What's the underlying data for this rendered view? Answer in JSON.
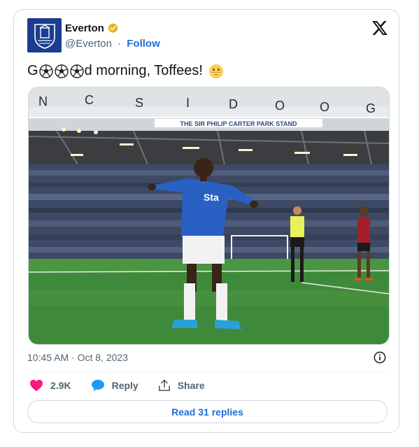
{
  "author": {
    "display_name": "Everton",
    "handle": "@Everton",
    "separator": "·",
    "follow_label": "Follow"
  },
  "tweet": {
    "text_prefix": "G",
    "text_suffix": "d morning, Toffees!",
    "emoji_ball_count": 3,
    "emoji_end": "grinning-face"
  },
  "media": {
    "stand_sign": "THE SIR PHILIP CARTER PARK STAND",
    "shirt_text": "Sta"
  },
  "meta": {
    "timestamp": "10:45 AM · Oct 8, 2023"
  },
  "actions": {
    "likes_count": "2.9K",
    "reply_label": "Reply",
    "share_label": "Share"
  },
  "footer": {
    "read_replies_label": "Read 31 replies"
  },
  "colors": {
    "accent": "#1d6ed8",
    "like": "#f91880",
    "reply_icon": "#1d9bf0",
    "everton_blue": "#1b3d8f",
    "pitch": "#3f8a3a"
  }
}
